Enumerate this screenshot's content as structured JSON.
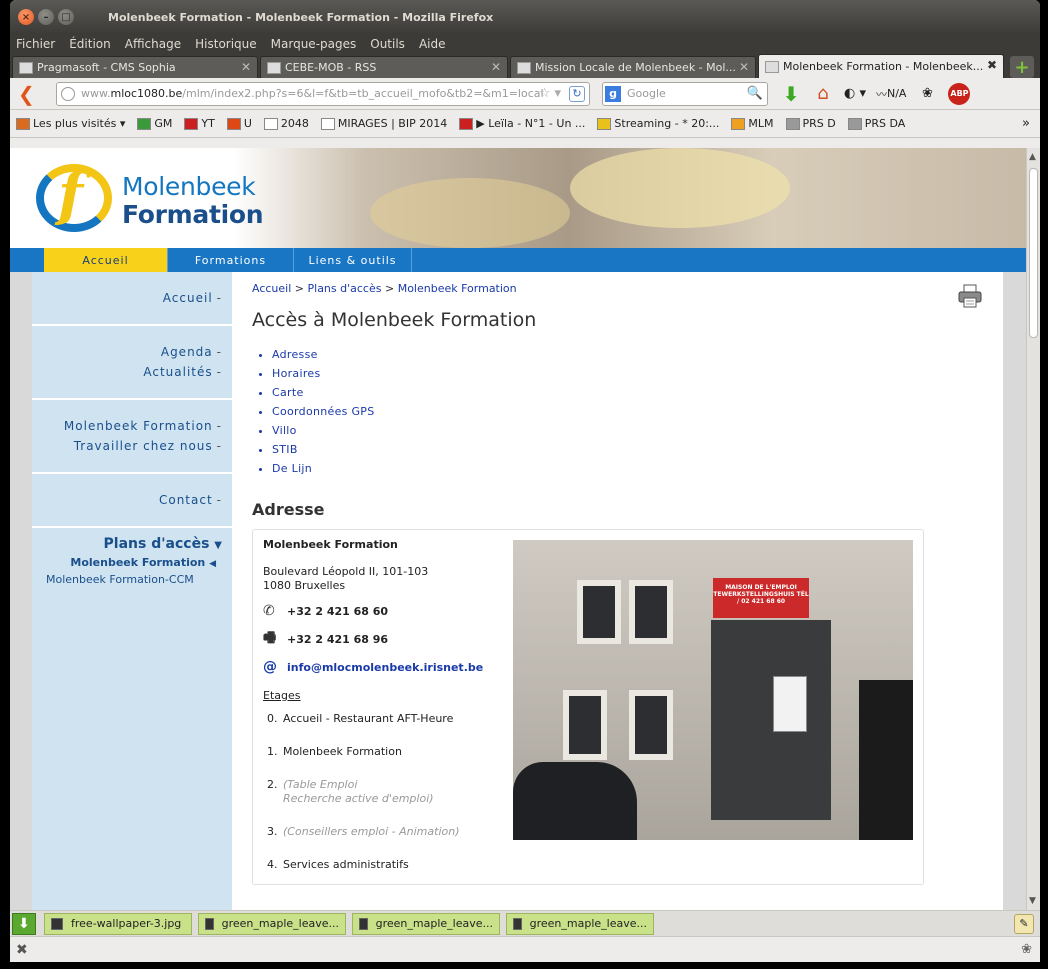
{
  "window": {
    "title": "Molenbeek Formation - Molenbeek Formation - Mozilla Firefox"
  },
  "menu": [
    "Fichier",
    "Édition",
    "Affichage",
    "Historique",
    "Marque-pages",
    "Outils",
    "Aide"
  ],
  "tabs": [
    {
      "label": "Pragmasoft - CMS Sophia",
      "active": false
    },
    {
      "label": "CEBE-MOB - RSS",
      "active": false
    },
    {
      "label": "Mission Locale de Molenbeek - Mol...",
      "active": false
    },
    {
      "label": "Molenbeek Formation - Molenbeek...",
      "active": true
    }
  ],
  "navbar": {
    "url_prefix": "www.",
    "url_domain": "mloc1080.be",
    "url_path": "/mlm/index2.php?s=6&l=f&tb=tb_accueil_mofo&tb2=&m1=local",
    "search_placeholder": "Google",
    "na_label": "N/A",
    "abp_label": "ABP"
  },
  "bookmarks": [
    {
      "label": "Les plus visités ▾",
      "icon": "folder-icon",
      "color": "#d96a1e"
    },
    {
      "label": "GM",
      "icon": "maps-icon",
      "color": "#3b9a3b"
    },
    {
      "label": "YT",
      "icon": "youtube-icon",
      "color": "#cc1f1f"
    },
    {
      "label": "U",
      "icon": "ubuntu-icon",
      "color": "#dd4814"
    },
    {
      "label": "2048",
      "icon": "page-icon",
      "color": "#ffffff"
    },
    {
      "label": "MIRAGES | BIP 2014",
      "icon": "page-icon",
      "color": "#ffffff"
    },
    {
      "label": "▶ Leïla - N°1 - Un ...",
      "icon": "youtube-icon",
      "color": "#cc1f1f"
    },
    {
      "label": "Streaming - * 20:...",
      "icon": "crown-icon",
      "color": "#e8c21a"
    },
    {
      "label": "MLM",
      "icon": "mlm-icon",
      "color": "#f0a020"
    },
    {
      "label": "PRS D",
      "icon": "cloud-icon",
      "color": "#999999"
    },
    {
      "label": "PRS DA",
      "icon": "cloud-icon",
      "color": "#999999"
    }
  ],
  "site": {
    "logo_line1": "Molenbeek",
    "logo_line2": "Formation",
    "logo_letter": "f",
    "topnav": [
      {
        "label": "Accueil",
        "active": true
      },
      {
        "label": "Formations",
        "active": false
      },
      {
        "label": "Liens & outils",
        "active": false
      }
    ],
    "sidebar": {
      "group1": [
        "Accueil"
      ],
      "group2": [
        "Agenda",
        "Actualités"
      ],
      "group3": [
        "Molenbeek Formation",
        "Travailler chez nous"
      ],
      "group4": [
        "Contact"
      ],
      "dash": "-",
      "plans_label": "Plans d'accès",
      "plans_sub": "Molenbeek Formation",
      "plans_sub2": "Molenbeek Formation-CCM"
    },
    "breadcrumb": {
      "items": [
        "Accueil",
        "Plans d'accès",
        "Molenbeek Formation"
      ],
      "sep": ">"
    },
    "page_title": "Accès à Molenbeek Formation",
    "anchors": [
      "Adresse",
      "Horaires",
      "Carte",
      "Coordonnées GPS",
      "Villo",
      "STIB",
      "De Lijn"
    ],
    "section_title": "Adresse",
    "address": {
      "name": "Molenbeek Formation",
      "street": "Boulevard Léopold II, 101-103",
      "city": "1080 Bruxelles",
      "phone": "+32 2 421 68 60",
      "fax": "+32 2 421 68 96",
      "email": "info@mlocmolenbeek.irisnet.be",
      "etages_title": "Etages",
      "banner_text": "MAISON DE L'EMPLOI TEWERKSTELLINGSHUIS TÉL / 02 421 68 60"
    },
    "etages": [
      {
        "num": "0.",
        "lines": [
          "Accueil - Restaurant AFT-Heure"
        ],
        "muted": false
      },
      {
        "num": "1.",
        "lines": [
          "Molenbeek Formation"
        ],
        "muted": false
      },
      {
        "num": "2.",
        "lines": [
          "(Table Emploi",
          "Recherche active d'emploi)"
        ],
        "muted": true
      },
      {
        "num": "3.",
        "lines": [
          "(Conseillers emploi - Animation)"
        ],
        "muted": true
      },
      {
        "num": "4.",
        "lines": [
          "Services administratifs"
        ],
        "muted": false
      }
    ]
  },
  "statusbar": {
    "downloads": [
      "free-wallpaper-3.jpg",
      "green_maple_leave...",
      "green_maple_leave...",
      "green_maple_leave..."
    ]
  }
}
